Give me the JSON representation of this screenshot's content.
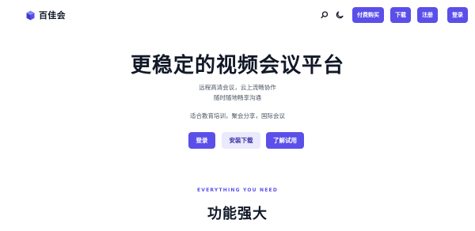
{
  "header": {
    "brand": "百佳会",
    "icons": {
      "logo": "cube-logo",
      "search": "search-icon",
      "theme": "moon-icon"
    },
    "buttons": {
      "buy": "付费购买",
      "download": "下载",
      "register": "注册",
      "login": "登录"
    }
  },
  "hero": {
    "title": "更稳定的视频会议平台",
    "subtitle_line1": "远程高清会议，云上流畅协作",
    "subtitle_line2": "随时随地畅享沟通",
    "use_cases": "适合教育培训，聚会分享，国际会议",
    "buttons": {
      "login": "登录",
      "install": "安装下载",
      "trial": "了解试用"
    }
  },
  "features": {
    "eyebrow": "EVERYTHING YOU NEED",
    "title": "功能强大"
  },
  "colors": {
    "accent": "#5b4fe9",
    "accent_light": "#ebe9fc",
    "text": "#111827",
    "muted": "#4b5563"
  }
}
